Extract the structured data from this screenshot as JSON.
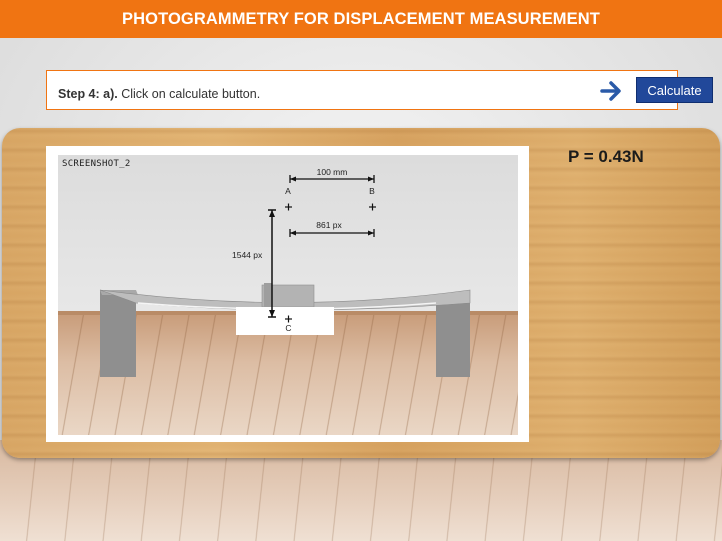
{
  "header": {
    "title": "PHOTOGRAMMETRY FOR DISPLACEMENT MEASUREMENT"
  },
  "instruction": {
    "step": "Step 4: a).",
    "text": " Click on calculate button.",
    "button_label": "Calculate"
  },
  "result": {
    "force_label": "P = 0.43N"
  },
  "screenshot": {
    "label": "SCREENSHOT_2",
    "dim_top": "100 mm",
    "dim_middle": "861 px",
    "dim_vertical": "1544 px",
    "point_a": "A",
    "point_b": "B",
    "point_c": "C"
  },
  "colors": {
    "accent": "#f07412",
    "button": "#21489a",
    "arrow": "#2a5aa8"
  }
}
